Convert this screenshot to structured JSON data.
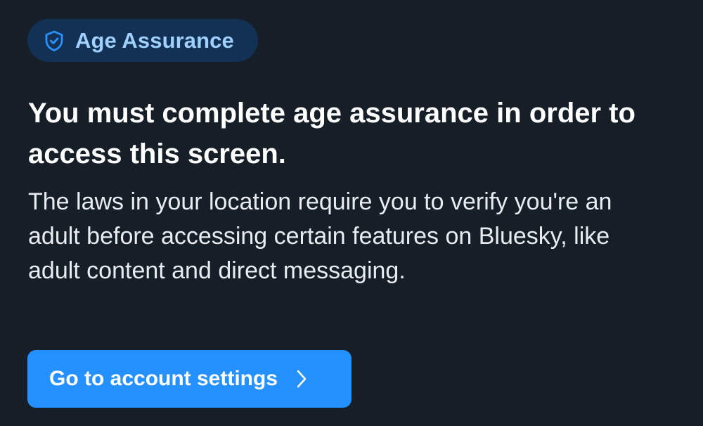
{
  "badge": {
    "label": "Age Assurance",
    "icon": "shield-check-icon",
    "color": "#9fd0ff",
    "background": "#123155"
  },
  "heading": "You must complete age assurance in order to access this screen.",
  "description": "The laws in your location require you to verify you're an adult before accessing certain features on Bluesky, like adult content and direct messaging.",
  "cta": {
    "label": "Go to account settings",
    "icon": "chevron-right-icon",
    "background": "#2590ff"
  },
  "colors": {
    "page_background": "#161e27",
    "text": "#ffffff"
  }
}
